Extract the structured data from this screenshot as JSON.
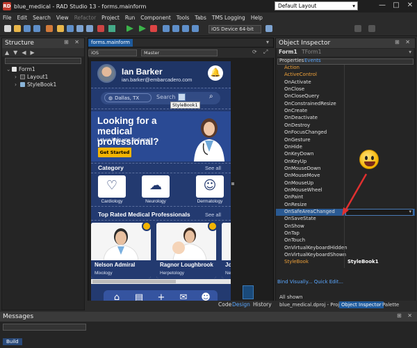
{
  "app": {
    "title": "blue_medical - RAD Studio 13 - forms.mainform",
    "logo_text": "RD",
    "layout_select": "Default Layout",
    "window_controls": [
      "—",
      "□",
      "✕"
    ]
  },
  "menu": [
    "File",
    "Edit",
    "Search",
    "View",
    "Refactor",
    "Project",
    "Run",
    "Component",
    "Tools",
    "Tabs",
    "TMS Logging",
    "Help"
  ],
  "toolbar": {
    "device": "iOS Device 64-bit"
  },
  "structure": {
    "title": "Structure",
    "controls": "⊞ ✕",
    "items": [
      {
        "label": "Form1"
      },
      {
        "label": "Layout1"
      },
      {
        "label": "StyleBook1"
      }
    ]
  },
  "designer": {
    "tab": "forms.mainform",
    "view_field": "iOS",
    "master_field": "Master",
    "bottom_tabs": [
      "Code",
      "Design",
      "History"
    ],
    "active_bottom_tab": "Design"
  },
  "phone": {
    "user_name": "Ian Barker",
    "user_email": "ian.barker@embarcadero.com",
    "location": "Dallas, TX",
    "search_placeholder": "Search",
    "stylebook_tip": "StyleBook1",
    "banner": {
      "headline": "Looking for a medical professional?",
      "subline": "Let us help you find one!",
      "cta": "Get Started"
    },
    "category_title": "Category",
    "see_all": "See all",
    "categories": [
      {
        "label": "Cardiology",
        "icon": "heart-pulse-icon"
      },
      {
        "label": "Neurology",
        "icon": "brain-icon"
      },
      {
        "label": "Dermatology",
        "icon": "face-magnify-icon"
      }
    ],
    "top_rated_title": "Top Rated Medical Professionals",
    "doctors": [
      {
        "name": "Nelson Admiral",
        "specialty": "Mixology"
      },
      {
        "name": "Ragnor Loughbrook",
        "specialty": "Herpetology"
      },
      {
        "name": "Jo",
        "specialty": "Ne"
      }
    ],
    "tab_icons": [
      "home-icon",
      "document-icon",
      "plus-icon",
      "chat-icon",
      "user-icon"
    ]
  },
  "inspector": {
    "title": "Object Inspector",
    "controls": "⊞ ✕",
    "object": "Form1",
    "object_type": "TForm1",
    "tabs": [
      "Properties",
      "Events"
    ],
    "active_tab": "Events",
    "events": [
      "Action",
      "ActiveControl",
      "OnActivate",
      "OnClose",
      "OnCloseQuery",
      "OnConstrainedResize",
      "OnCreate",
      "OnDeactivate",
      "OnDestroy",
      "OnFocusChanged",
      "OnGesture",
      "OnHide",
      "OnKeyDown",
      "OnKeyUp",
      "OnMouseDown",
      "OnMouseMove",
      "OnMouseUp",
      "OnMouseWheel",
      "OnPaint",
      "OnResize",
      "OnSafeAreaChanged",
      "OnSaveState",
      "OnShow",
      "OnTap",
      "OnTouch",
      "OnVirtualKeyboardHidden",
      "OnVirtualKeyboardShown",
      "StyleBook"
    ],
    "selected_event": "OnSafeAreaChanged",
    "stylebook_value": "StyleBook1",
    "footer_links": "Bind Visually...   Quick Edit...",
    "all_shown": "All shown",
    "bottom_tabs": [
      "blue_medical.dproj - Projects",
      "Object Inspector",
      "Palette"
    ]
  },
  "messages": {
    "title": "Messages",
    "controls": "⊞ ✕",
    "tab": "Build"
  },
  "colors": {
    "accent": "#1e5a9c",
    "arrow": "#e03030",
    "phone_bg": "#233a70",
    "cta": "#f4b400"
  }
}
